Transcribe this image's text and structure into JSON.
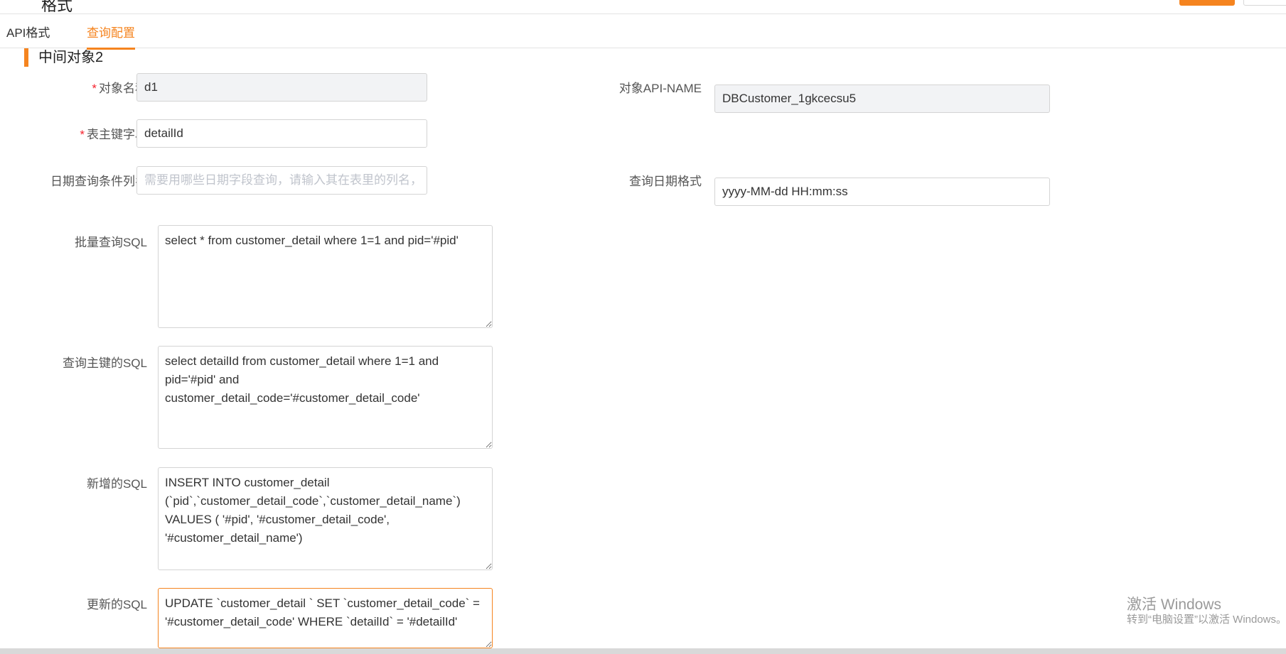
{
  "header": {
    "partial_title": "格式"
  },
  "tabs": [
    {
      "label": "API格式",
      "active": false
    },
    {
      "label": "查询配置",
      "active": true
    }
  ],
  "section": {
    "title": "中间对象2"
  },
  "form": {
    "object_name": {
      "label": "对象名称",
      "required": "*",
      "value": "d1"
    },
    "object_api_name": {
      "label": "对象API-NAME",
      "value": "DBCustomer_1gkcecsu5"
    },
    "primary_key_field": {
      "label": "表主键字段",
      "required": "*",
      "value": "detailId"
    },
    "date_query_column": {
      "label": "日期查询条件列名",
      "value": "",
      "placeholder": "需要用哪些日期字段查询，请输入其在表里的列名，多列以"
    },
    "date_format": {
      "label": "查询日期格式",
      "value": "yyyy-MM-dd HH:mm:ss"
    },
    "batch_query_sql": {
      "label": "批量查询SQL",
      "value": "select * from customer_detail where 1=1 and pid='#pid'"
    },
    "primary_key_sql": {
      "label": "查询主键的SQL",
      "value": "select detailId from customer_detail where 1=1 and pid='#pid' and customer_detail_code='#customer_detail_code'"
    },
    "insert_sql": {
      "label": "新增的SQL",
      "value": "INSERT INTO customer_detail (`pid`,`customer_detail_code`,`customer_detail_name`) VALUES ( '#pid', '#customer_detail_code', '#customer_detail_name')"
    },
    "update_sql": {
      "label": "更新的SQL",
      "value": "UPDATE `customer_detail ` SET `customer_detail_code` = '#customer_detail_code' WHERE `detailId` = '#detailId'"
    }
  },
  "watermark": {
    "line1": "激活 Windows",
    "line2": "转到“电脑设置”以激活 Windows。"
  },
  "colors": {
    "accent": "#f5841f",
    "required": "#f5222d",
    "border": "#d4d4d4",
    "disabled_bg": "#f2f3f5"
  }
}
